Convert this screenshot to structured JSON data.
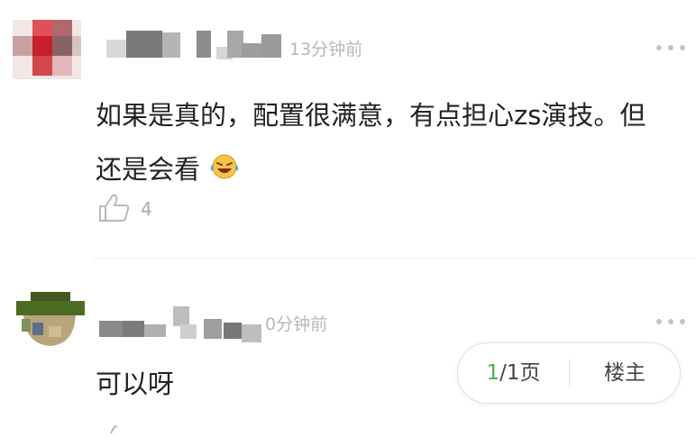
{
  "comments": [
    {
      "time": "13分钟前",
      "content": "如果是真的，配置很满意，有点担心zs演技。但还是会看",
      "emoji": "laughing-crying-emoji",
      "like_count": "4"
    },
    {
      "time": "0分钟前",
      "content": "可以呀"
    }
  ],
  "pager": {
    "current": "1",
    "rest": "/1页",
    "owner_label": "楼主"
  },
  "colors": {
    "accent": "#4caf50",
    "muted": "#b7b7b7"
  }
}
